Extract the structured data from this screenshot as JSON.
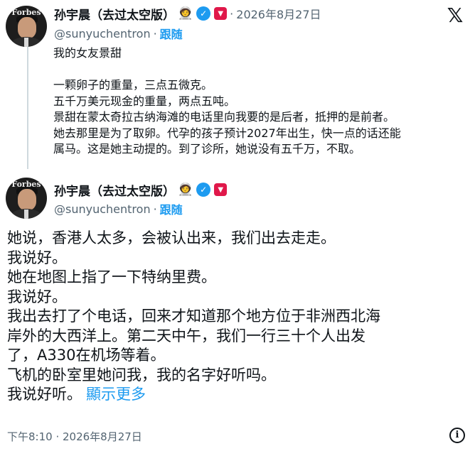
{
  "reply_post": {
    "author": {
      "display_name": "孙宇晨（去过太空版）",
      "handle": "@sunyuchentron",
      "follow_label": "跟随",
      "separator": "·",
      "avatar_label": "Forbes"
    },
    "timestamp": "2026年8月27日",
    "text_lines": [
      "我的女友景甜",
      "",
      "一颗卵子的重量，三点五微克。",
      "五千万美元现金的重量，两点五吨。",
      "景甜在蒙太奇拉古纳海滩的电话里向我要的是后者，抵押的是前者。",
      "她去那里是为了取卵。代孕的孩子预计2027年出生，快一点的话还能",
      "属马。这是她主动提的。到了诊所，她说没有五千万，不取。"
    ]
  },
  "main_post": {
    "author": {
      "display_name": "孙宇晨（去过太空版）",
      "handle": "@sunyuchentron",
      "follow_label": "跟随",
      "separator": "·",
      "avatar_label": "Forbes"
    },
    "text_lines": [
      "她说，香港人太多，会被认出来，我们出去走走。",
      "我说好。",
      "她在地图上指了一下特纳里费。",
      "我说好。",
      "我出去打了个电话，回来才知道那个地方位于非洲西北海",
      "岸外的大西洋上。第二天中午，我们一行三十个人出发",
      "了，A330在机场等着。",
      "飞机的卧室里她问我，我的名字好听吗。"
    ],
    "last_line": "我说好听。",
    "show_more_label": "顯示更多",
    "timestamp_footer": "下午8:10 · 2026年8月27日"
  },
  "icons": {
    "x_logo": "𝕏",
    "verified": "✓",
    "tron_badge": "▼",
    "emoji": "🧑‍🚀",
    "info": "i"
  },
  "colors": {
    "accent": "#1d9bf0",
    "secondary_text": "#536471",
    "primary_text": "#0f1419",
    "tron_red": "#e0184a"
  }
}
